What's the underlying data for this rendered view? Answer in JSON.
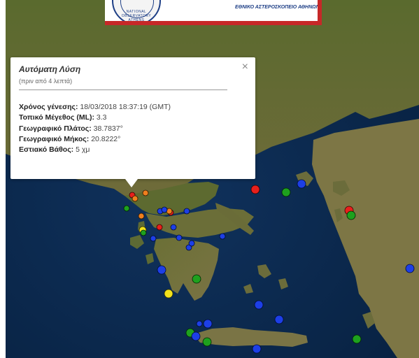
{
  "header": {
    "logo_icon": "observatory-seal-icon",
    "org_name": "ΕΘΝΙΚΟ ΑΣΤΕΡΟΣΚΟΠΕΙΟ ΑΘΗΝΩΝ",
    "logo_text": "NATIONAL OBSERVATORY ATHENS",
    "accent_color": "#c62828"
  },
  "popup": {
    "title": "Αυτόματη Λύση",
    "subtitle": "(πριν από 4 λεπτά)",
    "close_icon": "close-icon",
    "fields": [
      {
        "label": "Χρόνος γένεσης:",
        "value": "18/03/2018  18:37:19 (GMT)"
      },
      {
        "label": "Τοπικό Μέγεθος (ML):",
        "value": "3.3"
      },
      {
        "label": "Γεωγραφικό Πλάτος:",
        "value": "38.7837°"
      },
      {
        "label": "Γεωγραφικό Μήκος:",
        "value": "20.8222°"
      },
      {
        "label": "Εστιακό Βάθος:",
        "value": "5 χμ"
      }
    ]
  },
  "legend_colors": {
    "red": "#e8201c",
    "orange": "#f07f1e",
    "yellow": "#f2e21b",
    "green": "#1ea11e",
    "blue": "#1d3fe6"
  }
}
